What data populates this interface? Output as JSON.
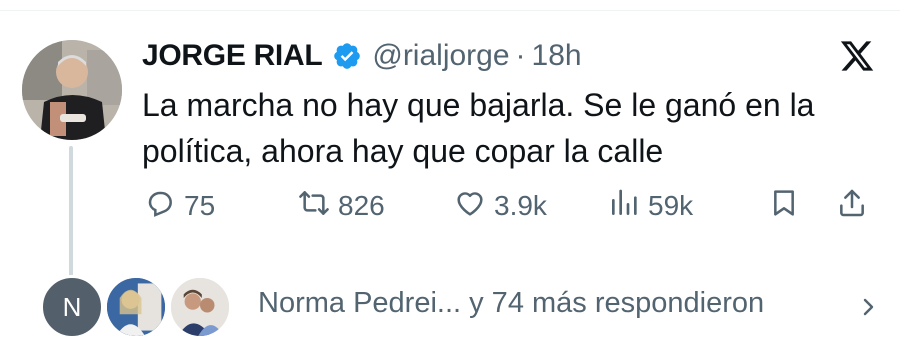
{
  "tweet": {
    "author_name": "JORGE RIAL",
    "handle": "@rialjorge",
    "separator": "·",
    "time": "18h",
    "text": "La marcha no hay que bajarla. Se le ganó en la política, ahora hay que copar la calle",
    "actions": {
      "replies": "75",
      "reposts": "826",
      "likes": "3.9k",
      "views": "59k"
    }
  },
  "replies_preview": {
    "initial": "N",
    "text": "Norma Pedrei... y 74 más respondieron"
  },
  "colors": {
    "verified": "#1d9bf0",
    "secondary_text": "#536471",
    "primary_text": "#0f1419"
  },
  "icons": [
    "verified-badge-icon",
    "x-logo-icon",
    "reply-icon",
    "repost-icon",
    "like-icon",
    "views-icon",
    "bookmark-icon",
    "share-icon",
    "chevron-right-icon"
  ]
}
